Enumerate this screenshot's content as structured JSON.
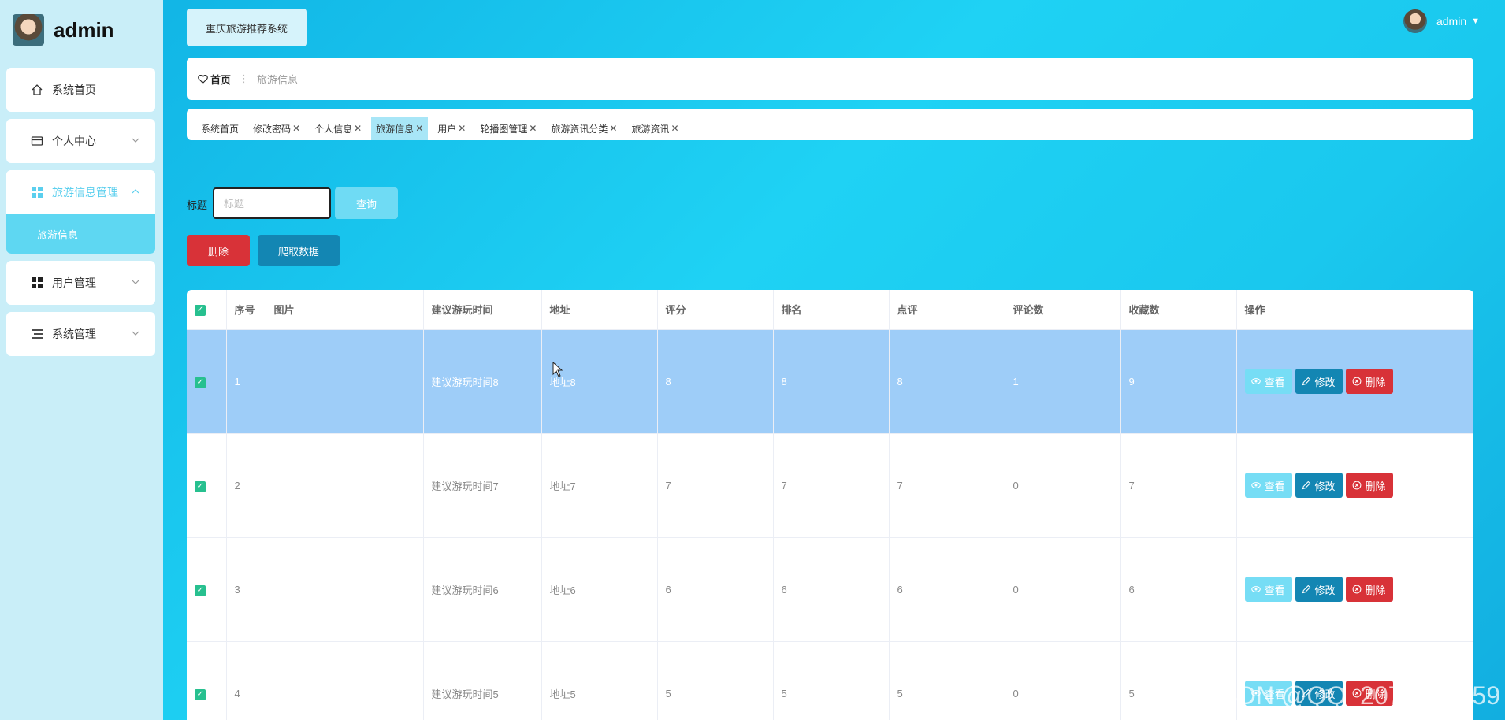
{
  "sidebar": {
    "username": "admin",
    "items": [
      {
        "label": "系统首页",
        "icon": "home-icon"
      },
      {
        "label": "个人中心",
        "icon": "card-icon"
      },
      {
        "label": "旅游信息管理",
        "icon": "grid-icon"
      },
      {
        "label": "用户管理",
        "icon": "grid-icon"
      },
      {
        "label": "系统管理",
        "icon": "list-icon"
      }
    ],
    "submenu": {
      "label": "旅游信息"
    }
  },
  "header": {
    "system_title": "重庆旅游推荐系统",
    "user": "admin"
  },
  "breadcrumb": {
    "home": "首页",
    "current": "旅游信息"
  },
  "tags": [
    {
      "label": "系统首页"
    },
    {
      "label": "修改密码"
    },
    {
      "label": "个人信息"
    },
    {
      "label": "旅游信息"
    },
    {
      "label": "用户"
    },
    {
      "label": "轮播图管理"
    },
    {
      "label": "旅游资讯分类"
    },
    {
      "label": "旅游资讯"
    }
  ],
  "search": {
    "label": "标题",
    "placeholder": "标题",
    "query_label": "查询"
  },
  "actions": {
    "delete_label": "删除",
    "crawl_label": "爬取数据"
  },
  "table": {
    "headers": [
      "序号",
      "图片",
      "建议游玩时间",
      "地址",
      "评分",
      "排名",
      "点评",
      "评论数",
      "收藏数",
      "操作"
    ],
    "rows": [
      {
        "no": "1",
        "time": "建议游玩时间8",
        "addr": "地址8",
        "score": "8",
        "rank": "8",
        "review": "8",
        "comments": "1",
        "fav": "9"
      },
      {
        "no": "2",
        "time": "建议游玩时间7",
        "addr": "地址7",
        "score": "7",
        "rank": "7",
        "review": "7",
        "comments": "0",
        "fav": "7"
      },
      {
        "no": "3",
        "time": "建议游玩时间6",
        "addr": "地址6",
        "score": "6",
        "rank": "6",
        "review": "6",
        "comments": "0",
        "fav": "6"
      },
      {
        "no": "4",
        "time": "建议游玩时间5",
        "addr": "地址5",
        "score": "5",
        "rank": "5",
        "review": "5",
        "comments": "0",
        "fav": "5"
      }
    ],
    "ops": {
      "view": "查看",
      "edit": "修改",
      "del": "删除"
    }
  },
  "watermark": "CSDN @QQ_2079523559",
  "colors": {
    "accent": "#1386b3",
    "danger": "#d83238",
    "selected_row": "#9ecdf8",
    "light_accent": "#6fdbf4"
  }
}
